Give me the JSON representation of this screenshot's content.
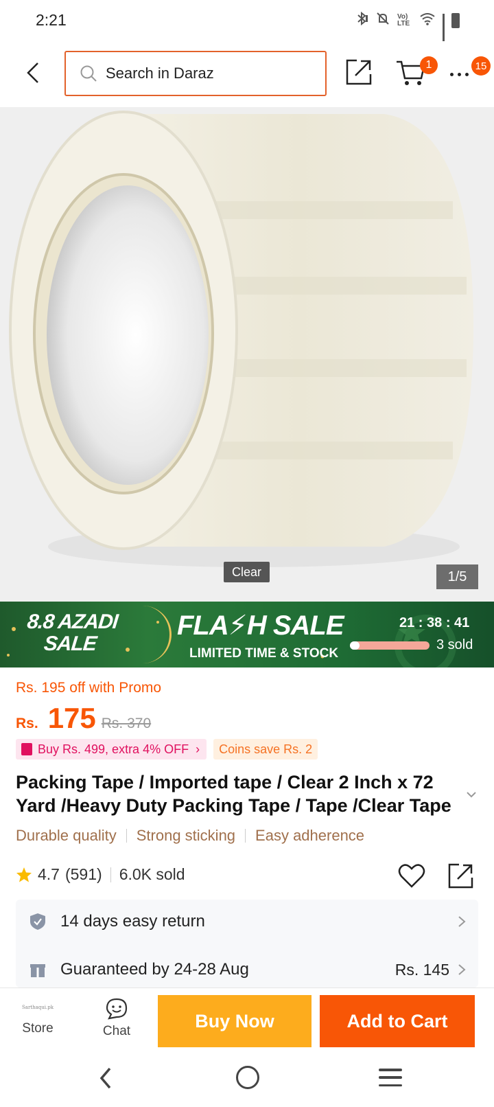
{
  "status_bar": {
    "time": "2:21",
    "network": "Vo) LTE"
  },
  "header": {
    "search_placeholder": "Search in Daraz",
    "cart_count": "1",
    "more_count": "15"
  },
  "gallery": {
    "image_label": "Clear",
    "counter": "1/5"
  },
  "flash_sale": {
    "event_line1": "8.8 AZADI",
    "event_line2": "SALE",
    "title": "FLA⚡H SALE",
    "subtitle": "LIMITED TIME & STOCK",
    "timer": "21 : 38 : 41",
    "sold": "3 sold",
    "sold_progress": 0.12
  },
  "price": {
    "promo_text": "Rs. 195 off with Promo",
    "currency": "Rs.",
    "current": "175",
    "original": "Rs. 370"
  },
  "tags": {
    "buy_more": "Buy Rs. 499, extra 4% OFF",
    "coins": "Coins save Rs. 2"
  },
  "product": {
    "title": "Packing Tape / Imported tape / Clear 2 Inch x 72 Yard /Heavy Duty Packing Tape / Tape /Clear Tape",
    "features": [
      "Durable quality",
      "Strong sticking",
      "Easy adherence"
    ],
    "rating": "4.7",
    "reviews": "(591)",
    "sold": "6.0K sold"
  },
  "services": {
    "return_text": "14 days easy return",
    "delivery_text": "Guaranteed by 24-28 Aug",
    "delivery_fee": "Rs. 145"
  },
  "bottom_bar": {
    "store_label": "Store",
    "store_logo_text": "Sarthaqui.pk",
    "chat_label": "Chat",
    "buy_now": "Buy Now",
    "add_to_cart": "Add to Cart"
  },
  "colors": {
    "accent": "#f85606",
    "buy_now": "#fdac1d",
    "flash_green": "#2b7a3a"
  }
}
